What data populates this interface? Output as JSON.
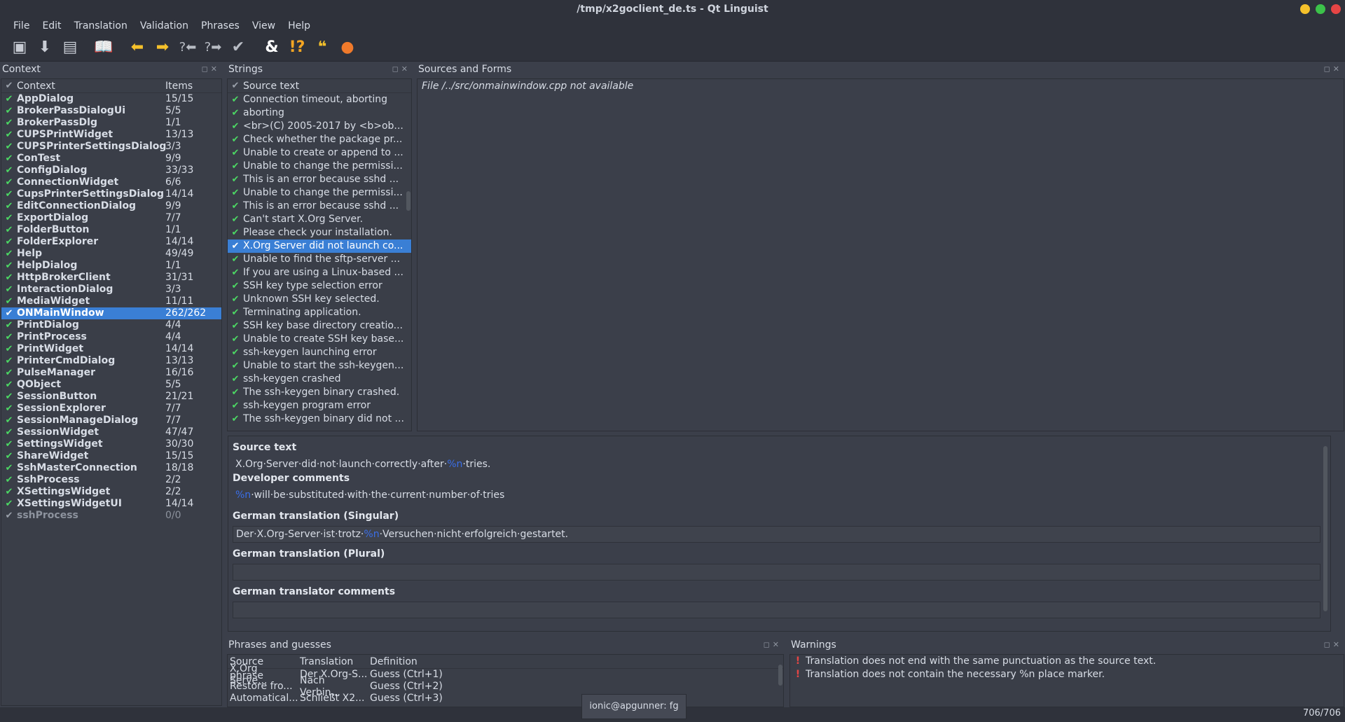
{
  "window": {
    "title": "/tmp/x2goclient_de.ts - Qt Linguist"
  },
  "menu": [
    "File",
    "Edit",
    "Translation",
    "Validation",
    "Phrases",
    "View",
    "Help"
  ],
  "toolbar_icons": [
    "open-icon",
    "save-icon",
    "print-icon",
    "phrasebook-icon",
    "prev-icon",
    "next-icon",
    "prev-unfinished-icon",
    "next-unfinished-icon",
    "done-next-icon",
    "accelerator-check-icon",
    "punctuation-check-icon",
    "phrase-check-icon",
    "placemarker-check-icon"
  ],
  "context_panel": {
    "title": "Context",
    "headers": {
      "context": "Context",
      "items": "Items"
    },
    "rows": [
      {
        "name": "AppDialog",
        "items": "15/15"
      },
      {
        "name": "BrokerPassDialogUi",
        "items": "5/5"
      },
      {
        "name": "BrokerPassDlg",
        "items": "1/1"
      },
      {
        "name": "CUPSPrintWidget",
        "items": "13/13"
      },
      {
        "name": "CUPSPrinterSettingsDialog",
        "items": "3/3"
      },
      {
        "name": "ConTest",
        "items": "9/9"
      },
      {
        "name": "ConfigDialog",
        "items": "33/33"
      },
      {
        "name": "ConnectionWidget",
        "items": "6/6"
      },
      {
        "name": "CupsPrinterSettingsDialog",
        "items": "14/14"
      },
      {
        "name": "EditConnectionDialog",
        "items": "9/9"
      },
      {
        "name": "ExportDialog",
        "items": "7/7"
      },
      {
        "name": "FolderButton",
        "items": "1/1"
      },
      {
        "name": "FolderExplorer",
        "items": "14/14"
      },
      {
        "name": "Help",
        "items": "49/49"
      },
      {
        "name": "HelpDialog",
        "items": "1/1"
      },
      {
        "name": "HttpBrokerClient",
        "items": "31/31"
      },
      {
        "name": "InteractionDialog",
        "items": "3/3"
      },
      {
        "name": "MediaWidget",
        "items": "11/11"
      },
      {
        "name": "ONMainWindow",
        "items": "262/262"
      },
      {
        "name": "PrintDialog",
        "items": "4/4"
      },
      {
        "name": "PrintProcess",
        "items": "4/4"
      },
      {
        "name": "PrintWidget",
        "items": "14/14"
      },
      {
        "name": "PrinterCmdDialog",
        "items": "13/13"
      },
      {
        "name": "PulseManager",
        "items": "16/16"
      },
      {
        "name": "QObject",
        "items": "5/5"
      },
      {
        "name": "SessionButton",
        "items": "21/21"
      },
      {
        "name": "SessionExplorer",
        "items": "7/7"
      },
      {
        "name": "SessionManageDialog",
        "items": "7/7"
      },
      {
        "name": "SessionWidget",
        "items": "47/47"
      },
      {
        "name": "SettingsWidget",
        "items": "30/30"
      },
      {
        "name": "ShareWidget",
        "items": "15/15"
      },
      {
        "name": "SshMasterConnection",
        "items": "18/18"
      },
      {
        "name": "SshProcess",
        "items": "2/2"
      },
      {
        "name": "XSettingsWidget",
        "items": "2/2"
      },
      {
        "name": "XSettingsWidgetUI",
        "items": "14/14"
      },
      {
        "name": "sshProcess",
        "items": "0/0"
      }
    ],
    "selected_index": 18,
    "obsolete_index": 35
  },
  "strings_panel": {
    "title": "Strings",
    "header": "Source text",
    "rows": [
      "Connection timeout, aborting",
      "aborting",
      "<br>(C) 2005-2017 by <b>ob...",
      "Check whether the package pr...",
      "Unable to create or append to ...",
      "Unable to change the permissi...",
      "This is an error because sshd ...",
      "Unable to change the permissi...",
      "This is an error because sshd ...",
      "Can't start X.Org Server.",
      "Please check your installation.",
      "X.Org Server did not launch co...",
      "Unable to find the sftp-server ...",
      "If you are using a Linux-based ...",
      "SSH key type selection error",
      "Unknown SSH key selected.",
      "Terminating application.",
      "SSH key base directory creatio...",
      "Unable to create SSH key base...",
      "ssh-keygen launching error",
      "Unable to start the ssh-keygen...",
      "ssh-keygen crashed",
      "The ssh-keygen binary crashed.",
      "ssh-keygen program error",
      "The ssh-keygen binary did not ..."
    ],
    "selected_index": 11
  },
  "sources_panel": {
    "title": "Sources and Forms",
    "message": "File /../src/onmainwindow.cpp not available"
  },
  "editor": {
    "source_label": "Source text",
    "source_before": "X.Org·Server·did·not·launch·correctly·after·",
    "source_marker": "%n",
    "source_after": "·tries.",
    "dev_comments_label": "Developer comments",
    "dev_marker": "%n",
    "dev_after": "·will·be·substituted·with·the·current·number·of·tries",
    "singular_label": "German translation (Singular)",
    "singular_before": "Der·X.Org-Server·ist·trotz·",
    "singular_marker": "%n",
    "singular_after": "·Versuchen·nicht·erfolgreich·gestartet.",
    "plural_label": "German translation (Plural)",
    "plural_value": "",
    "translator_comments_label": "German translator comments",
    "translator_comments_value": ""
  },
  "phrases_panel": {
    "title": "Phrases and guesses",
    "headers": [
      "Source phrase",
      "Translation",
      "Definition"
    ],
    "rows": [
      [
        "X.Org Serve...",
        "Der X.Org-S...",
        "Guess (Ctrl+1)"
      ],
      [
        "Restore fro...",
        "Nach Verbin...",
        "Guess (Ctrl+2)"
      ],
      [
        "Automatical...",
        "Schließt X2...",
        "Guess (Ctrl+3)"
      ]
    ]
  },
  "warnings_panel": {
    "title": "Warnings",
    "items": [
      "Translation does not end with the same punctuation as the source text.",
      "Translation does not contain the necessary %n place marker."
    ]
  },
  "status": {
    "count": "706/706"
  },
  "tooltip": {
    "text": "ionic@apgunner:  fg"
  },
  "colors": {
    "accent": "#3a7fd5",
    "check": "#4cd964",
    "marker": "#3a6ee8"
  }
}
